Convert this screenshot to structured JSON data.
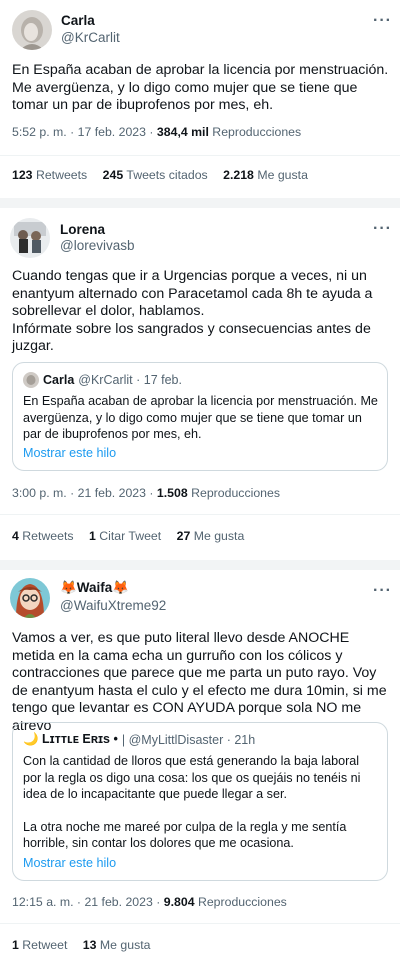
{
  "tweets": [
    {
      "name": "Carla",
      "handle": "@KrCarlit",
      "text": "En España acaban de aprobar la licencia por menstruación. Me avergüenza, y lo digo como mujer que se tiene que tomar un par de ibuprofenos por mes, eh.",
      "time": "5:52 p. m. · 17 feb. 2023 · ",
      "views": "384,4 mil",
      "views_label": " Reproducciones",
      "stats": [
        {
          "value": "123",
          "label": " Retweets"
        },
        {
          "value": "245",
          "label": " Tweets citados"
        },
        {
          "value": "2.218",
          "label": " Me gusta"
        }
      ]
    },
    {
      "name": "Lorena",
      "handle": "@lorevivasb",
      "paragraphs": [
        "Cuando tengas que ir a Urgencias porque a veces, ni un enantyum alternado con Paracetamol cada 8h te ayuda a sobrellevar el dolor, hablamos.",
        "Infórmate sobre los sangrados y consecuencias antes de juzgar."
      ],
      "quote": {
        "name": "Carla",
        "handle": "@KrCarlit · 17 feb.",
        "text": "En España acaban de aprobar la licencia por menstruación. Me avergüenza, y lo digo como mujer que se tiene que tomar un par de ibuprofenos por mes, eh.",
        "link": "Mostrar este hilo"
      },
      "time": "3:00 p. m. · 21 feb. 2023 · ",
      "views": "1.508",
      "views_label": " Reproducciones",
      "stats": [
        {
          "value": "4",
          "label": " Retweets"
        },
        {
          "value": "1",
          "label": " Citar Tweet"
        },
        {
          "value": "27",
          "label": " Me gusta"
        }
      ]
    },
    {
      "name": "🦊Waifa🦊",
      "handle": "@WaifuXtreme92",
      "text": "Vamos a ver, es que puto literal llevo desde ANOCHE metida en la cama echa un gurruño con los cólicos y contracciones que parece que me parta un puto rayo. Voy de enantyum hasta el culo y el efecto me dura 10min, si me tengo que levantar es CON AYUDA porque sola NO me atrevo",
      "quote": {
        "name": "🌙 Lɪᴛᴛʟᴇ Eʀɪs •",
        "handle": "| @MyLittlDisaster · 21h",
        "paragraphs": [
          "Con la cantidad de lloros que está generando la baja laboral por la regla os digo una cosa: los que os quejáis no tenéis ni idea de lo incapacitante que puede llegar a ser.",
          "La otra noche me mareé por culpa de la regla y me sentía horrible, sin contar los dolores que me ocasiona."
        ],
        "link": "Mostrar este hilo"
      },
      "time": "12:15 a. m. · 21 feb. 2023 · ",
      "views": "9.804",
      "views_label": " Reproducciones",
      "stats": [
        {
          "value": "1",
          "label": " Retweet"
        },
        {
          "value": "13",
          "label": " Me gusta"
        }
      ]
    }
  ],
  "more_icon": "more-dots-icon"
}
